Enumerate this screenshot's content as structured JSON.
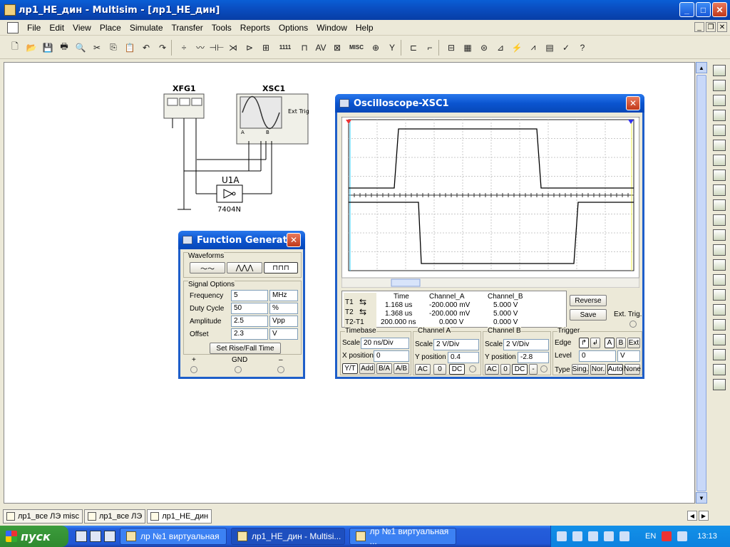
{
  "window": {
    "title": "лр1_НЕ_дин - Multisim - [лр1_НЕ_дин]",
    "min": "_",
    "max": "□",
    "close": "✕"
  },
  "menu": [
    "File",
    "Edit",
    "View",
    "Place",
    "Simulate",
    "Transfer",
    "Tools",
    "Reports",
    "Options",
    "Window",
    "Help"
  ],
  "toolbar": {
    "glyphs": [
      "🗋",
      "📂",
      "💾",
      "🖶",
      "🔍",
      "✂",
      "⎘",
      "📋",
      "↶",
      "↷",
      "|",
      "÷",
      "〰",
      "⊣⊢",
      "⋊",
      "⊳",
      "⊞",
      "1111",
      "⊓",
      "AV",
      "⊠",
      "MISC",
      "⊕",
      "Y",
      "|",
      "⊏",
      "⌐",
      "|",
      "⊟",
      "▦",
      "⊜",
      "⊿",
      "⚡",
      "⩘",
      "▤",
      "✓",
      "?"
    ]
  },
  "schematic": {
    "xfg1": "XFG1",
    "xsc1": "XSC1",
    "u1a": "U1A",
    "part": "7404N",
    "ext_trig": "Ext Trig",
    "ch_a": "A",
    "ch_b": "B"
  },
  "function_generator": {
    "title": "Function Generat...",
    "waveforms_label": "Waveforms",
    "signal_options_label": "Signal Options",
    "rows": [
      {
        "label": "Frequency",
        "value": "5",
        "unit": "MHz"
      },
      {
        "label": "Duty Cycle",
        "value": "50",
        "unit": "%"
      },
      {
        "label": "Amplitude",
        "value": "2.5",
        "unit": "Vpp"
      },
      {
        "label": "Offset",
        "value": "2.3",
        "unit": "V"
      }
    ],
    "rise_fall_button": "Set Rise/Fall Time",
    "terminals": [
      "+",
      "GND",
      "–"
    ]
  },
  "oscilloscope": {
    "title": "Oscilloscope-XSC1",
    "readout_headers": [
      "Time",
      "Channel_A",
      "Channel_B"
    ],
    "t1": {
      "label": "T1",
      "time": "1.168 us",
      "a": "-200.000 mV",
      "b": "5.000 V"
    },
    "t2": {
      "label": "T2",
      "time": "1.368 us",
      "a": "-200.000 mV",
      "b": "5.000 V"
    },
    "t2t1": {
      "label": "T2-T1",
      "time": "200.000 ns",
      "a": "0.000 V",
      "b": "0.000 V"
    },
    "reverse": "Reverse",
    "save": "Save",
    "ext_trig": "Ext. Trig.",
    "timebase": {
      "label": "Timebase",
      "scale_label": "Scale",
      "scale": "20 ns/Div",
      "xpos_label": "X position",
      "xpos": "0",
      "buttons": [
        "Y/T",
        "Add",
        "B/A",
        "A/B"
      ]
    },
    "channel_a": {
      "label": "Channel A",
      "scale_label": "Scale",
      "scale": "2  V/Div",
      "ypos_label": "Y position",
      "ypos": "0.4",
      "buttons": [
        "AC",
        "0",
        "DC"
      ]
    },
    "channel_b": {
      "label": "Channel B",
      "scale_label": "Scale",
      "scale": "2  V/Div",
      "ypos_label": "Y position",
      "ypos": "-2.8",
      "buttons": [
        "AC",
        "0",
        "DC",
        "-"
      ]
    },
    "trigger": {
      "label": "Trigger",
      "edge_label": "Edge",
      "edge_buttons": [
        "↱",
        "↲"
      ],
      "source_buttons": [
        "A",
        "B",
        "Ext"
      ],
      "level_label": "Level",
      "level": "0",
      "level_unit": "V",
      "type_label": "Type",
      "type_buttons": [
        "Sing.",
        "Nor.",
        "Auto",
        "None"
      ]
    }
  },
  "tabs": [
    {
      "label": "лр1_все ЛЭ misc",
      "active": false
    },
    {
      "label": "лр1_все ЛЭ",
      "active": false
    },
    {
      "label": "лр1_НЕ_дин",
      "active": true
    }
  ],
  "taskbar": {
    "start": "пуск",
    "tasks": [
      {
        "label": "лр №1 виртуальная",
        "active": false
      },
      {
        "label": "лр1_НЕ_дин - Multisi...",
        "active": true
      },
      {
        "label": "лр №1 виртуальная ...",
        "active": false
      }
    ],
    "lang": "EN",
    "clock": "13:13"
  }
}
